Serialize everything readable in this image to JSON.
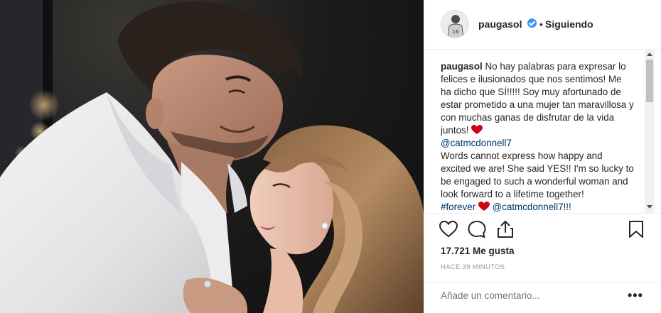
{
  "header": {
    "username": "paugasol",
    "separator": "•",
    "follow_status": "Siguiendo"
  },
  "caption": {
    "username": "paugasol",
    "text_es": "No hay palabras para expresar lo felices e ilusionados que nos sentimos! Me ha dicho que SÍ!!!!! Soy muy afortunado de estar prometido a una mujer tan maravillosa y con muchas ganas de disfrutar de la vida juntos!",
    "mention_1": "@catmcdonnell7",
    "text_en": "Words cannot express how happy and excited we are! She said YES!! I'm so lucky to be engaged to such a wonderful woman and look forward to a lifetime together!",
    "hashtag": "#forever",
    "mention_2": "@catmcdonnell7!!!"
  },
  "actions": {
    "like_icon": "heart-outline-icon",
    "comment_icon": "speech-bubble-icon",
    "share_icon": "share-icon",
    "save_icon": "bookmark-icon"
  },
  "likes_text": "17.721 Me gusta",
  "time_text": "HACE 39 MINUTOS",
  "comment_box": {
    "placeholder": "Añade un comentario...",
    "more_label": "•••"
  },
  "colors": {
    "verified": "#3897f0",
    "link": "#003569",
    "heart": "#ed4956",
    "muted": "#999999"
  }
}
